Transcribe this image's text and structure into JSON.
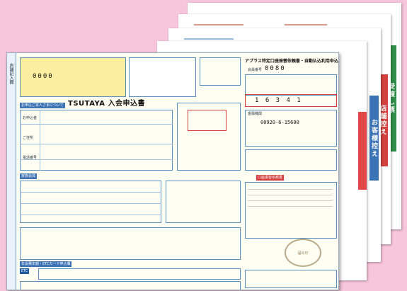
{
  "sheets": {
    "band_receipt": "受渡し票",
    "band_store": "店舗控え",
    "band_customer": "お客様控え"
  },
  "form": {
    "side_label": "店舗記入欄",
    "title": "TSUTAYA 入会申込書",
    "right_title": "アプラス特定口座振替依頼書・自動払込利用申込書",
    "number_label": "会員番号",
    "number_value": "0080",
    "card_digits": "1 6 3 4 1",
    "left_digits": "0000",
    "bank_number": "00920-6-15600",
    "etc_label": "ETC",
    "stamp_text": "届出印",
    "applicant_label": "お申込者",
    "address_label": "ご住所",
    "phone_label": "電話番号",
    "bank_label": "金融機関",
    "section_apply": "お申込ご本人さまについて",
    "section_family": "家族会員",
    "section_etc": "年会費年額・ETCカード申込欄",
    "section_bank": "口座振替依頼書"
  },
  "colors": {
    "background": "#f7c6dc",
    "green": "#2f8f4a",
    "red": "#d3413f",
    "blue": "#3b73b5",
    "yellow": "#fbeea0"
  }
}
